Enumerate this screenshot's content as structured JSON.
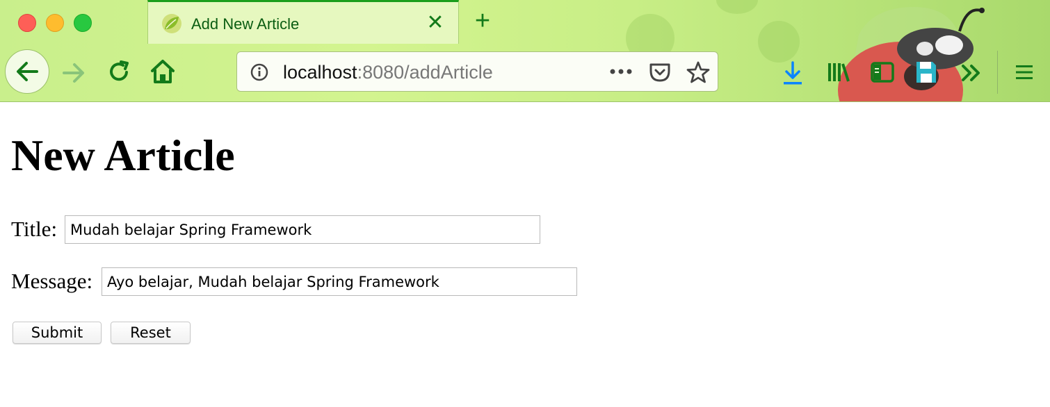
{
  "browser": {
    "tab_title": "Add New Article",
    "url_host": "localhost",
    "url_rest": ":8080/addArticle",
    "accent_color": "#137a1a"
  },
  "page": {
    "heading": "New Article",
    "form": {
      "title_label": "Title:",
      "title_value": "Mudah belajar Spring Framework",
      "message_label": "Message:",
      "message_value": "Ayo belajar, Mudah belajar Spring Framework",
      "submit_label": "Submit",
      "reset_label": "Reset"
    }
  },
  "icons": [
    "back-arrow-icon",
    "forward-arrow-icon",
    "reload-icon",
    "home-icon",
    "info-icon",
    "more-icon",
    "pocket-icon",
    "bookmark-star-icon",
    "download-icon",
    "library-icon",
    "sidebar-icon",
    "save-icon",
    "overflow-chevron-icon",
    "hamburger-menu-icon"
  ]
}
